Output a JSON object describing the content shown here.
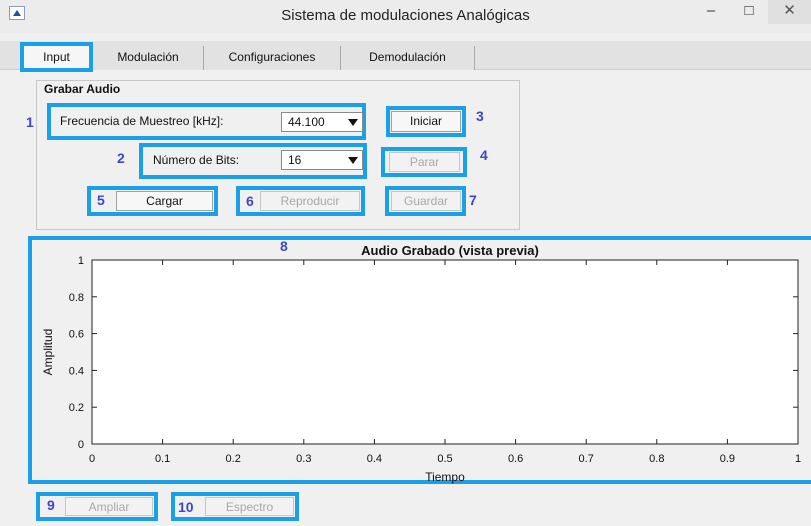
{
  "window": {
    "title": "Sistema de modulaciones Analógicas",
    "minimize_glyph": "–",
    "maximize_glyph": "□",
    "close_glyph": "✕"
  },
  "tabs": [
    {
      "label": "Input",
      "active": true
    },
    {
      "label": "Modulación",
      "active": false
    },
    {
      "label": "Configuraciones",
      "active": false
    },
    {
      "label": "Demodulación",
      "active": false
    }
  ],
  "record_panel": {
    "title": "Grabar Audio",
    "sample_rate_label": "Frecuencia de Muestreo [kHz]:",
    "sample_rate_value": "44.100",
    "bits_label": "Número de Bits:",
    "bits_value": "16",
    "start_button": "Iniciar",
    "stop_button": "Parar",
    "load_button": "Cargar",
    "play_button": "Reproducir",
    "save_button": "Guardar"
  },
  "markers": [
    "1",
    "2",
    "3",
    "4",
    "5",
    "6",
    "7",
    "8",
    "9",
    "10"
  ],
  "bottom": {
    "zoom_button": "Ampliar",
    "spectrum_button": "Espectro"
  },
  "accent_color": "#1aa0e8",
  "marker_color": "#3d47c9",
  "chart_data": {
    "type": "line",
    "title": "Audio Grabado (vista previa)",
    "xlabel": "Tiempo",
    "ylabel": "Amplitud",
    "xlim": [
      0,
      1
    ],
    "ylim": [
      0,
      1
    ],
    "x_ticks": [
      "0",
      "0.1",
      "0.2",
      "0.3",
      "0.4",
      "0.5",
      "0.6",
      "0.7",
      "0.8",
      "0.9",
      "1"
    ],
    "y_ticks": [
      "0",
      "0.2",
      "0.4",
      "0.6",
      "0.8",
      "1"
    ],
    "series": [],
    "grid": false
  }
}
